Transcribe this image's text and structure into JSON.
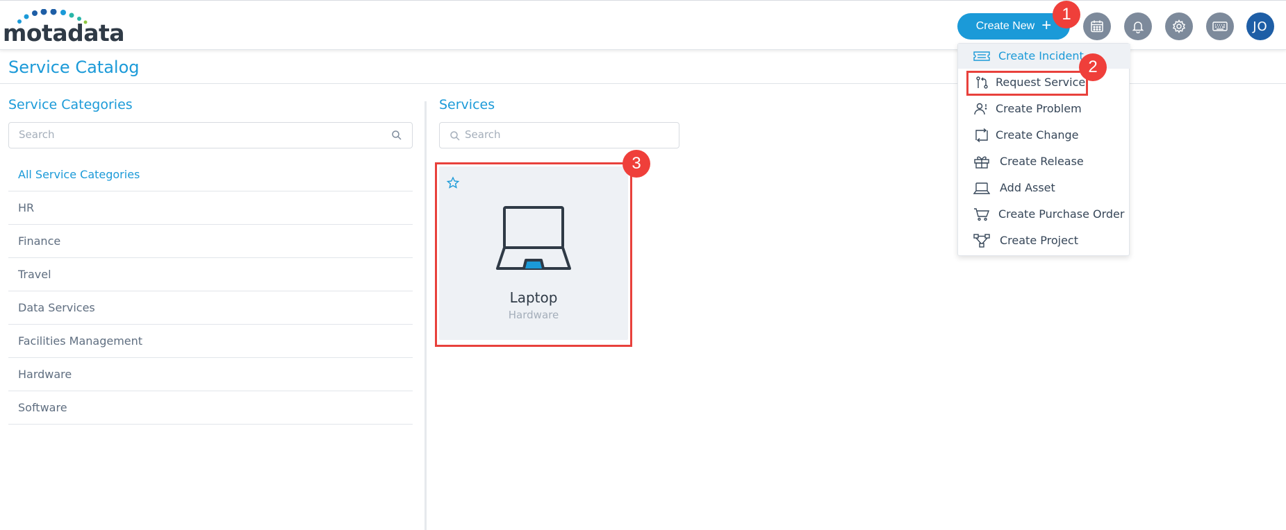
{
  "header": {
    "logo_text": "motadata",
    "create_new_label": "Create New",
    "create_new_icon": "plus-icon",
    "icons": [
      "calendar-icon",
      "bell-icon",
      "gear-icon",
      "keyboard-icon"
    ],
    "avatar_initials": "JO"
  },
  "dropdown": {
    "items": [
      {
        "label": "Create Incident",
        "icon": "ticket-icon"
      },
      {
        "label": "Request Service",
        "icon": "git-pull-icon"
      },
      {
        "label": "Create Problem",
        "icon": "user-question-icon"
      },
      {
        "label": "Create Change",
        "icon": "change-arrows-icon"
      },
      {
        "label": "Create Release",
        "icon": "gift-box-icon"
      },
      {
        "label": "Add Asset",
        "icon": "laptop-icon"
      },
      {
        "label": "Create Purchase Order",
        "icon": "cart-icon"
      },
      {
        "label": "Create Project",
        "icon": "project-tree-icon"
      }
    ]
  },
  "page_title": "Service Catalog",
  "categories": {
    "title": "Service Categories",
    "search_placeholder": "Search",
    "items": [
      "All Service Categories",
      "HR",
      "Finance",
      "Travel",
      "Data Services",
      "Facilities Management",
      "Hardware",
      "Software"
    ]
  },
  "services": {
    "title": "Services",
    "search_placeholder": "Search",
    "cards": [
      {
        "name": "Laptop",
        "category": "Hardware",
        "icon": "laptop-icon"
      }
    ]
  },
  "annotations": [
    "1",
    "2",
    "3"
  ],
  "colors": {
    "accent": "#1b9ad8",
    "annotation_red": "#e8413c",
    "header_icon_bg": "#7d8a9b",
    "avatar_bg": "#1e5ea6"
  }
}
